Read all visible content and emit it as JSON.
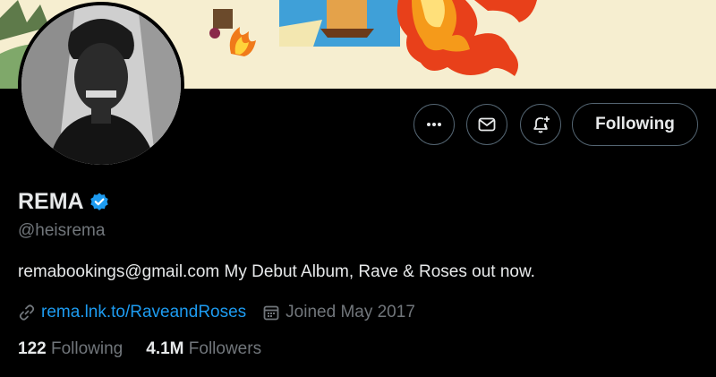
{
  "profile": {
    "name": "REMA",
    "handle": "@heisrema",
    "bio": "remabookings@gmail.com My Debut Album, Rave & Roses out now.",
    "website": "rema.lnk.to/RaveandRoses",
    "joined": "Joined May 2017",
    "verified": true
  },
  "actions": {
    "follow_label": "Following"
  },
  "stats": {
    "following_count": "122",
    "following_label": "Following",
    "followers_count": "4.1M",
    "followers_label": "Followers"
  },
  "icons": {
    "more": "more-icon",
    "message": "envelope-icon",
    "notify": "bell-plus-icon",
    "link": "link-icon",
    "calendar": "calendar-icon",
    "verified": "verified-badge-icon"
  },
  "colors": {
    "background": "#000000",
    "accent": "#1d9bf0",
    "muted": "#71767b",
    "text": "#e7e9ea",
    "banner": "#f6eed0"
  }
}
